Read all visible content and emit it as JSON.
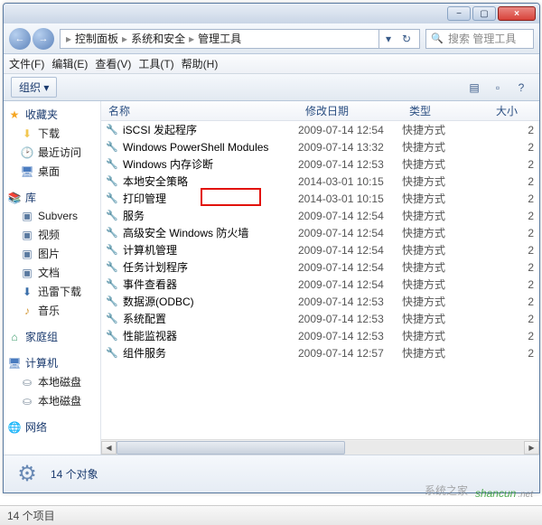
{
  "window": {
    "min_icon": "−",
    "max_icon": "▢",
    "close_icon": "×"
  },
  "nav": {
    "back_icon": "←",
    "fwd_icon": "→",
    "refresh_icon": "↻",
    "dropdown_icon": "▾",
    "search_placeholder": "搜索 管理工具",
    "crumbs": [
      "控制面板",
      "系统和安全",
      "管理工具"
    ],
    "sep": "▸"
  },
  "menu": {
    "file": "文件(F)",
    "edit": "编辑(E)",
    "view": "查看(V)",
    "tools": "工具(T)",
    "help": "帮助(H)"
  },
  "toolbar": {
    "organize": "组织 ▾",
    "views_icon": "▤",
    "preview_icon": "▫",
    "help_icon": "?"
  },
  "sidebar": {
    "favorites": "收藏夹",
    "downloads": "下载",
    "recent": "最近访问",
    "desktop": "桌面",
    "libraries": "库",
    "subversion": "Subvers",
    "videos": "视频",
    "pictures": "图片",
    "documents": "文档",
    "xl_downloads": "迅雷下载",
    "music": "音乐",
    "homegroup": "家庭组",
    "computer": "计算机",
    "local_disk": "本地磁盘",
    "local_disk2": "本地磁盘",
    "network": "网络"
  },
  "columns": {
    "name": "名称",
    "date": "修改日期",
    "type": "类型",
    "size": "大小"
  },
  "files": [
    {
      "name": "iSCSI 发起程序",
      "date": "2009-07-14 12:54",
      "type": "快捷方式",
      "size": "2"
    },
    {
      "name": "Windows PowerShell Modules",
      "date": "2009-07-14 13:32",
      "type": "快捷方式",
      "size": "2"
    },
    {
      "name": "Windows 内存诊断",
      "date": "2009-07-14 12:53",
      "type": "快捷方式",
      "size": "2"
    },
    {
      "name": "本地安全策略",
      "date": "2014-03-01 10:15",
      "type": "快捷方式",
      "size": "2"
    },
    {
      "name": "打印管理",
      "date": "2014-03-01 10:15",
      "type": "快捷方式",
      "size": "2"
    },
    {
      "name": "服务",
      "date": "2009-07-14 12:54",
      "type": "快捷方式",
      "size": "2"
    },
    {
      "name": "高级安全 Windows 防火墙",
      "date": "2009-07-14 12:54",
      "type": "快捷方式",
      "size": "2"
    },
    {
      "name": "计算机管理",
      "date": "2009-07-14 12:54",
      "type": "快捷方式",
      "size": "2"
    },
    {
      "name": "任务计划程序",
      "date": "2009-07-14 12:54",
      "type": "快捷方式",
      "size": "2"
    },
    {
      "name": "事件查看器",
      "date": "2009-07-14 12:54",
      "type": "快捷方式",
      "size": "2"
    },
    {
      "name": "数据源(ODBC)",
      "date": "2009-07-14 12:53",
      "type": "快捷方式",
      "size": "2"
    },
    {
      "name": "系统配置",
      "date": "2009-07-14 12:53",
      "type": "快捷方式",
      "size": "2"
    },
    {
      "name": "性能监视器",
      "date": "2009-07-14 12:53",
      "type": "快捷方式",
      "size": "2"
    },
    {
      "name": "组件服务",
      "date": "2009-07-14 12:57",
      "type": "快捷方式",
      "size": "2"
    }
  ],
  "details": {
    "count": "14 个对象"
  },
  "status": {
    "items": "14 个项目"
  },
  "watermark": {
    "text1": "shancun",
    "text2": ".net",
    "text3": "系统之家"
  }
}
